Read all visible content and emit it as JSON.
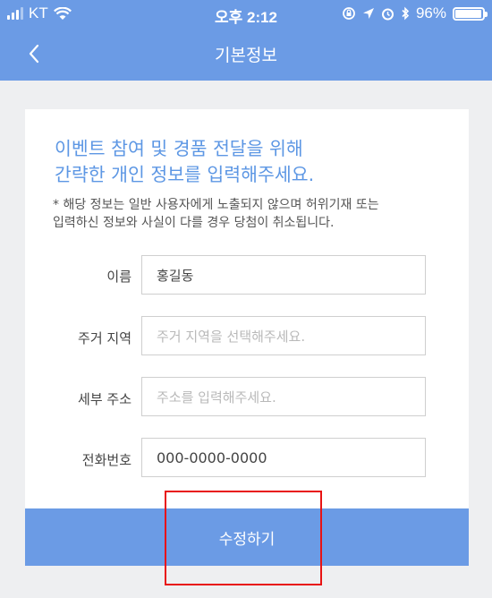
{
  "status_bar": {
    "carrier": "KT",
    "time": "오후 2:12",
    "battery_percent": "96%",
    "battery_level": 0.96,
    "icons": [
      "signal-icon",
      "wifi-icon",
      "rotation-lock-icon",
      "location-icon",
      "alarm-icon",
      "bluetooth-icon",
      "battery-icon"
    ]
  },
  "nav": {
    "title": "기본정보",
    "back_icon": "chevron-left-icon"
  },
  "form": {
    "heading_line1": "이벤트 참여 및 경품 전달을 위해",
    "heading_line2": "간략한 개인 정보를 입력해주세요.",
    "notice_line1": "* 해당 정보는 일반 사용자에게 노출되지 않으며 허위기재 또는",
    "notice_line2": "입력하신 정보와 사실이 다를 경우 당첨이 취소됩니다.",
    "fields": [
      {
        "label": "이름",
        "value": "홍길동",
        "placeholder": ""
      },
      {
        "label": "주거 지역",
        "value": "",
        "placeholder": "주거 지역을 선택해주세요."
      },
      {
        "label": "세부 주소",
        "value": "",
        "placeholder": "주소를 입력해주세요."
      },
      {
        "label": "전화번호",
        "value": "000-0000-0000",
        "placeholder": ""
      }
    ]
  },
  "submit_label": "수정하기",
  "colors": {
    "accent": "#6b9be5",
    "heading": "#5d97e4",
    "highlight": "#e81313"
  }
}
